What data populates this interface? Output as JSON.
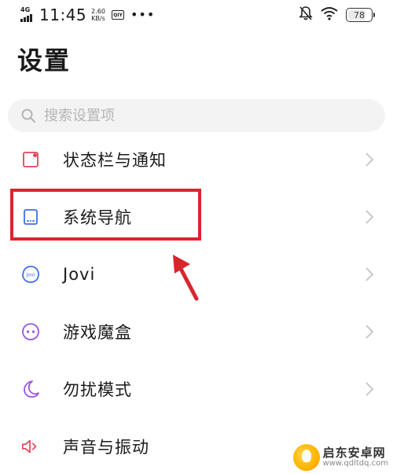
{
  "status_bar": {
    "network": "4G",
    "time": "11:45",
    "speed_value": "2.60",
    "speed_unit": "KB/s",
    "app_badge": "iQIYI",
    "battery": "78",
    "battery_level": 0.78
  },
  "page": {
    "title": "设置"
  },
  "search": {
    "placeholder": "搜索设置项"
  },
  "settings": {
    "items": [
      {
        "label": "状态栏与通知",
        "icon": "status-bar-icon",
        "color": "#e8415a"
      },
      {
        "label": "系统导航",
        "icon": "system-navigation-icon",
        "color": "#3d6fe8"
      },
      {
        "label": "Jovi",
        "icon": "jovi-icon",
        "color": "#3d6fe8"
      },
      {
        "label": "游戏魔盒",
        "icon": "game-box-icon",
        "color": "#9a55e0"
      },
      {
        "label": "勿扰模式",
        "icon": "do-not-disturb-icon",
        "color": "#9a55e0"
      },
      {
        "label": "声音与振动",
        "icon": "sound-icon",
        "color": "#e8415a"
      }
    ]
  },
  "annotation": {
    "highlight_color": "#d8262f",
    "highlighted_item": "系统导航"
  },
  "watermark": {
    "name": "启东安卓网",
    "url": "www.qdltdq.com"
  }
}
